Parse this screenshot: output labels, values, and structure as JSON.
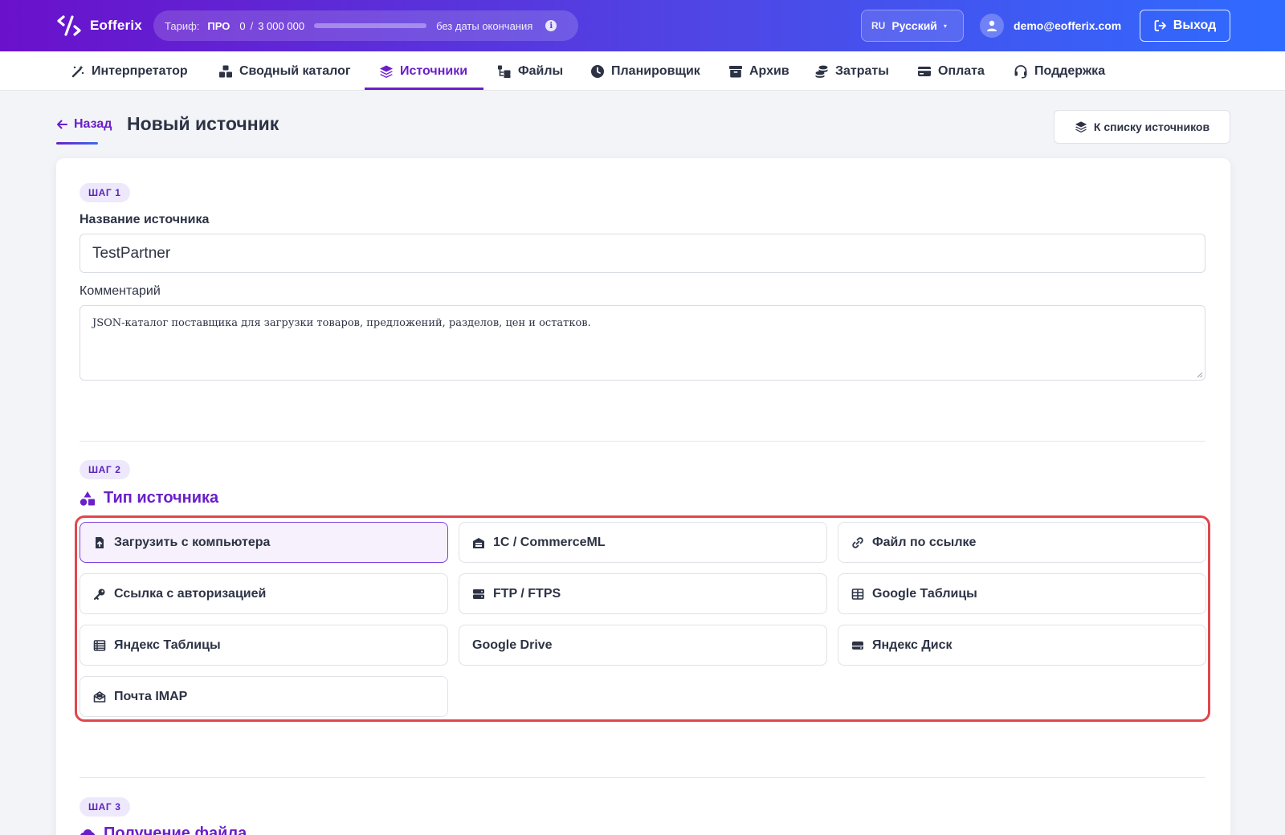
{
  "app": {
    "name": "Eofferix"
  },
  "tariff": {
    "label": "Тариф:",
    "plan": "ПРО",
    "used": "0",
    "separator": "/",
    "limit": "3 000 000",
    "progress": 0,
    "until": "без даты окончания",
    "info_icon": "i"
  },
  "language": {
    "code": "RU",
    "name": "Русский",
    "caret": "▾"
  },
  "user": {
    "email": "demo@eofferix.com"
  },
  "logout": {
    "label": "Выход"
  },
  "nav": [
    {
      "label": "Интерпретатор",
      "icon": "wand-icon"
    },
    {
      "label": "Сводный каталог",
      "icon": "boxes-icon"
    },
    {
      "label": "Источники",
      "icon": "layers-icon",
      "active": true
    },
    {
      "label": "Файлы",
      "icon": "folder-tree-icon"
    },
    {
      "label": "Планировщик",
      "icon": "clock-icon"
    },
    {
      "label": "Архив",
      "icon": "archive-icon"
    },
    {
      "label": "Затраты",
      "icon": "coins-icon"
    },
    {
      "label": "Оплата",
      "icon": "credit-card-icon"
    },
    {
      "label": "Поддержка",
      "icon": "headset-icon"
    }
  ],
  "header": {
    "back": "Назад",
    "title": "Новый источник",
    "to_list": "К списку источников"
  },
  "step1": {
    "badge": "ШАГ 1",
    "name_label": "Название источника",
    "name_value": "TestPartner",
    "comment_label": "Комментарий",
    "comment_value": "JSON-каталог поставщика для загрузки товаров, предложений, разделов, цен и остатков."
  },
  "step2": {
    "badge": "ШАГ 2",
    "title": "Тип источника",
    "options": [
      {
        "label": "Загрузить с компьютера",
        "icon": "file-upload-icon",
        "selected": true
      },
      {
        "label": "1С / CommerceML",
        "icon": "warehouse-icon"
      },
      {
        "label": "Файл по ссылке",
        "icon": "link-icon"
      },
      {
        "label": "Ссылка с авторизацией",
        "icon": "key-icon"
      },
      {
        "label": "FTP / FTPS",
        "icon": "server-icon"
      },
      {
        "label": "Google Таблицы",
        "icon": "table-icon"
      },
      {
        "label": "Яндекс Таблицы",
        "icon": "list-table-icon"
      },
      {
        "label": "Google Drive",
        "icon": ""
      },
      {
        "label": "Яндекс Диск",
        "icon": "hard-drive-icon"
      },
      {
        "label": "Почта IMAP",
        "icon": "envelope-open-icon"
      }
    ]
  },
  "step3": {
    "badge": "ШАГ 3",
    "title": "Получение файла"
  },
  "colors": {
    "accent": "#6a1fc8",
    "highlight": "#e0474c",
    "header_gradient_start": "#6a11cb",
    "header_gradient_end": "#2f6bff"
  }
}
